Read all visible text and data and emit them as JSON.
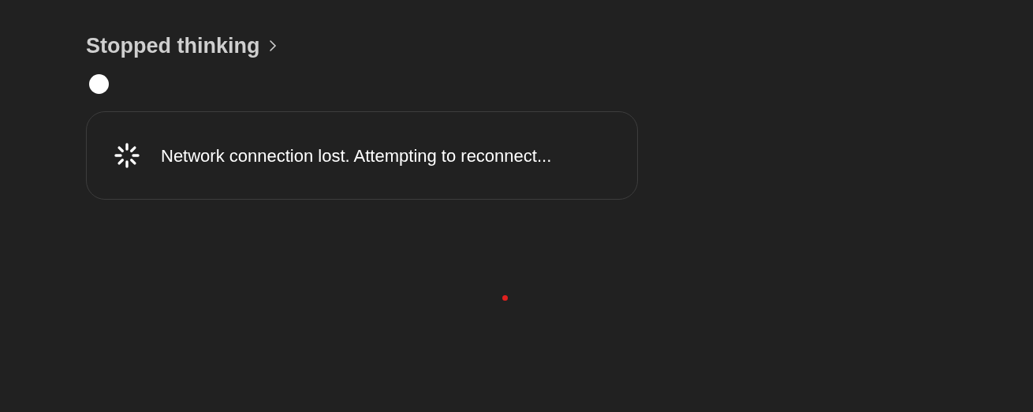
{
  "thinking": {
    "label": "Stopped thinking"
  },
  "status": {
    "message": "Network connection lost. Attempting to reconnect..."
  }
}
